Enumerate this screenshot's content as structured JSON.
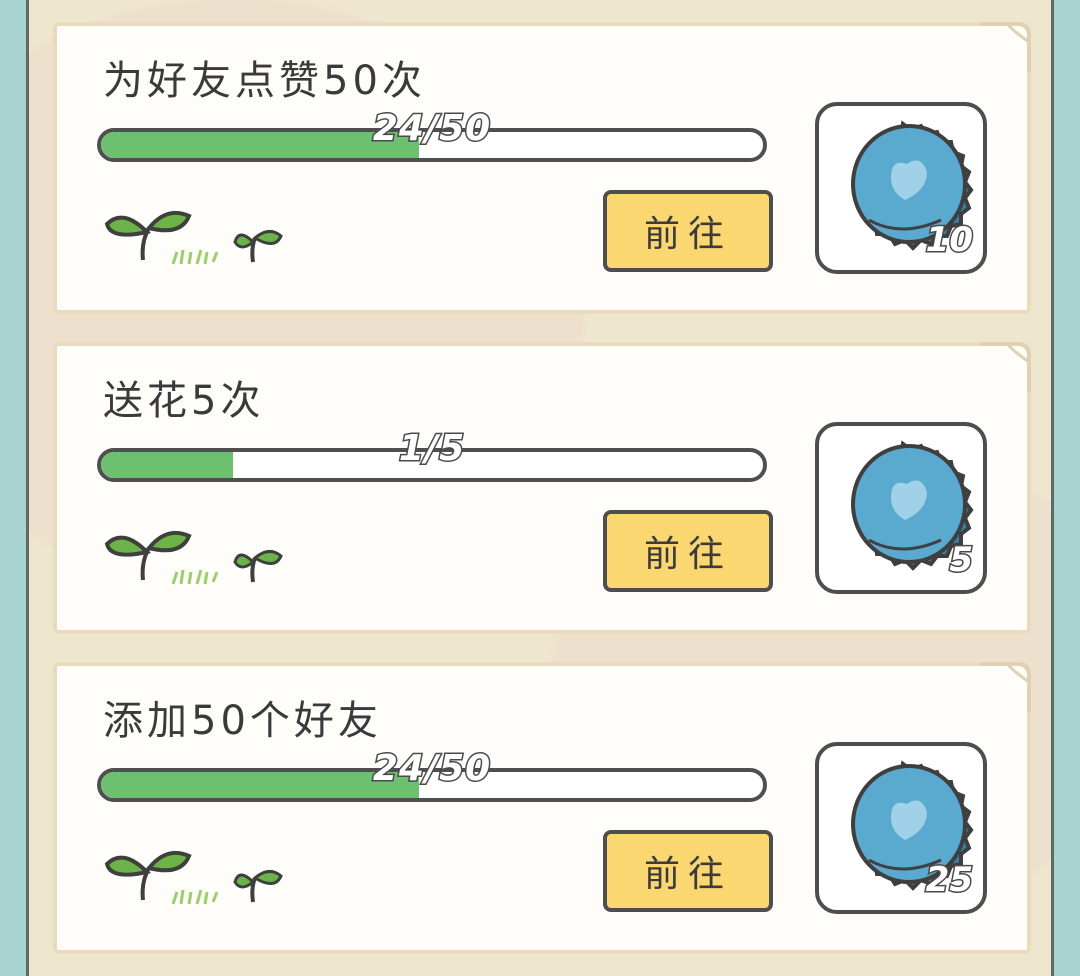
{
  "tasks": [
    {
      "title": "为好友点赞50次",
      "progress_text": "24/50",
      "progress_fraction": 0.48,
      "button_label": "前往",
      "reward_count": "10",
      "reward_icon": "bottle-cap-icon"
    },
    {
      "title": "送花5次",
      "progress_text": "1/5",
      "progress_fraction": 0.2,
      "button_label": "前往",
      "reward_count": "5",
      "reward_icon": "bottle-cap-icon"
    },
    {
      "title": "添加50个好友",
      "progress_text": "24/50",
      "progress_fraction": 0.48,
      "button_label": "前往",
      "reward_count": "25",
      "reward_icon": "bottle-cap-icon"
    }
  ],
  "colors": {
    "progress_fill": "#6cc06f",
    "button_bg": "#fbd772",
    "cap_blue": "#5aa9cf",
    "sprout_green": "#6cb34a",
    "background_teal": "#a9d3d0"
  }
}
